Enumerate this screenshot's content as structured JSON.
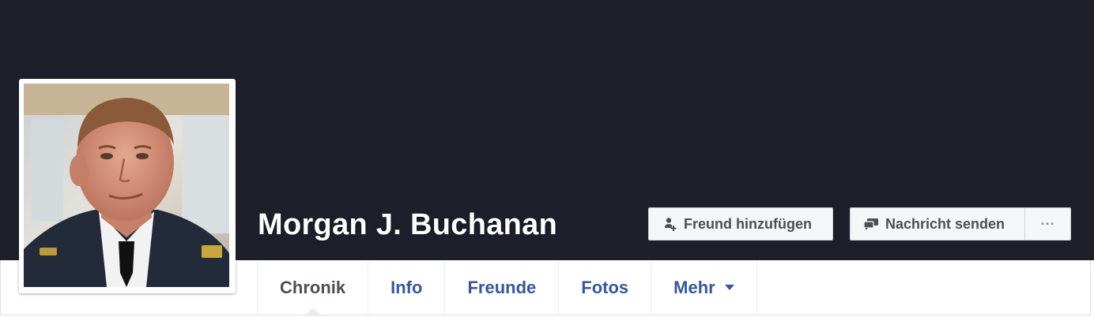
{
  "profile": {
    "name": "Morgan J. Buchanan"
  },
  "actions": {
    "add_friend_label": "Freund hinzufügen",
    "send_message_label": "Nachricht senden",
    "more_label": "···"
  },
  "tabs": [
    {
      "label": "Chronik",
      "active": true
    },
    {
      "label": "Info",
      "active": false
    },
    {
      "label": "Freunde",
      "active": false
    },
    {
      "label": "Fotos",
      "active": false
    },
    {
      "label": "Mehr",
      "active": false,
      "dropdown": true
    }
  ],
  "colors": {
    "cover": "#1d202b",
    "link": "#365899",
    "active_tab": "#4b4f56",
    "button_bg": "#f5f6f7"
  },
  "icons": {
    "add_friend": "add-friend-icon",
    "message": "message-icon",
    "more": "more-dots-icon",
    "dropdown": "caret-down-icon"
  }
}
